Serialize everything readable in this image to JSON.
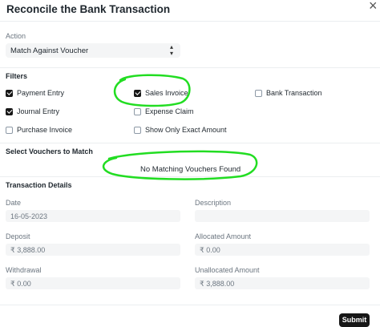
{
  "dialog": {
    "title": "Reconcile the Bank Transaction",
    "close_glyph": "×"
  },
  "action": {
    "label": "Action",
    "selected": "Match Against Voucher",
    "chevron_icon": "up-down-chevron-icon"
  },
  "filters": {
    "title": "Filters",
    "items": [
      {
        "label": "Payment Entry",
        "checked": true
      },
      {
        "label": "Sales Invoice",
        "checked": true
      },
      {
        "label": "Bank Transaction",
        "checked": false
      },
      {
        "label": "Journal Entry",
        "checked": true
      },
      {
        "label": "Expense Claim",
        "checked": false
      },
      {
        "label": "Purchase Invoice",
        "checked": false
      },
      {
        "label": "Show Only Exact Amount",
        "checked": false
      }
    ]
  },
  "vouchers": {
    "title": "Select Vouchers to Match",
    "empty_message": "No Matching Vouchers Found"
  },
  "transaction": {
    "title": "Transaction Details",
    "date_label": "Date",
    "date_value": "16-05-2023",
    "description_label": "Description",
    "description_value": "",
    "deposit_label": "Deposit",
    "deposit_value": "₹ 3,888.00",
    "allocated_label": "Allocated Amount",
    "allocated_value": "₹ 0.00",
    "withdrawal_label": "Withdrawal",
    "withdrawal_value": "₹ 0.00",
    "unallocated_label": "Unallocated Amount",
    "unallocated_value": "₹ 3,888.00"
  },
  "footer": {
    "submit_label": "Submit"
  },
  "colors": {
    "annotation": "#22dd22",
    "primary_button": "#171717",
    "field_bg": "#f4f5f6"
  }
}
